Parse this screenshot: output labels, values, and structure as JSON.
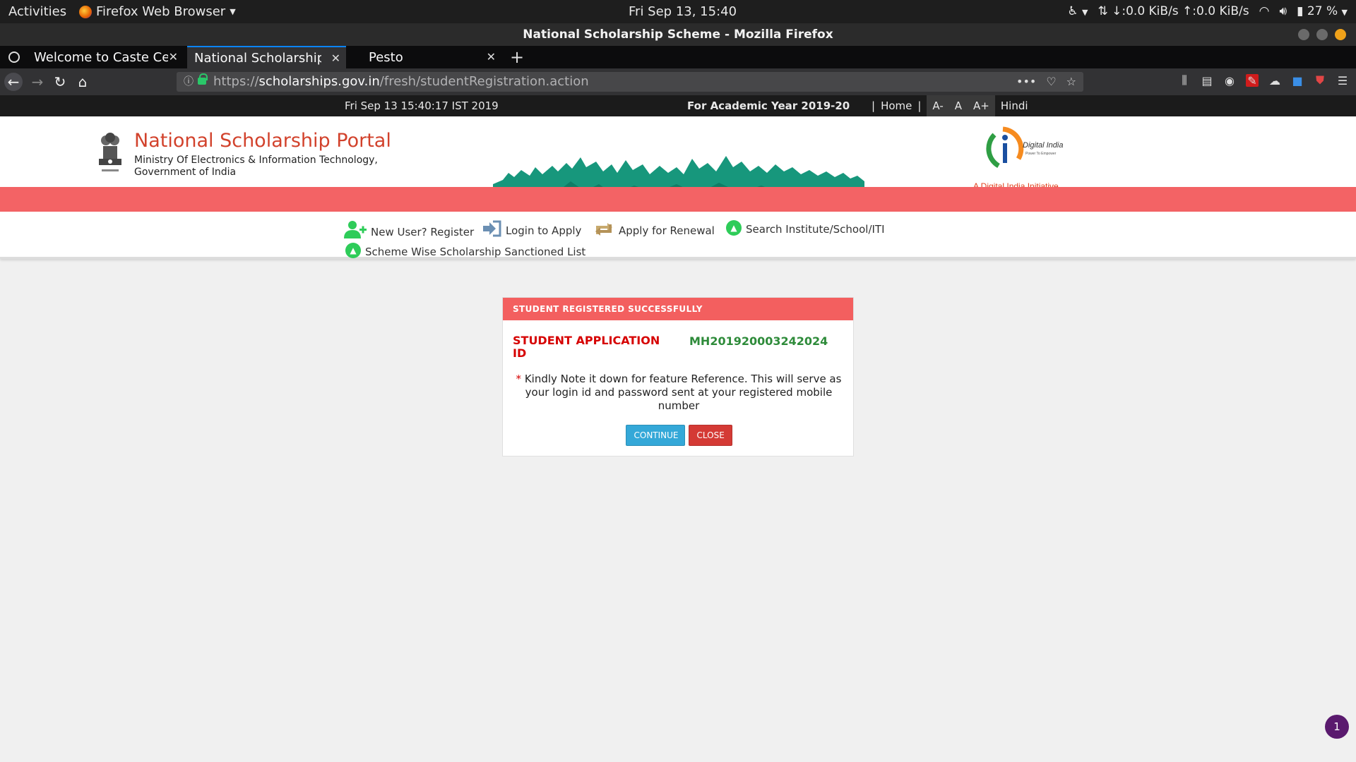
{
  "gnome_bar": {
    "activities": "Activities",
    "app_name": "Firefox Web Browser",
    "clock": "Fri Sep 13, 15:40",
    "network_speed": "↓:0.0 KiB/s ↑:0.0 KiB/s",
    "battery": "27 %"
  },
  "window": {
    "title": "National Scholarship Scheme - Mozilla Firefox"
  },
  "tabs": [
    {
      "title": "Welcome to Caste Cer"
    },
    {
      "title": "National Scholarship S"
    },
    {
      "title": "Pesto"
    }
  ],
  "urlbar": {
    "scheme": "https://",
    "host": "scholarships.gov.in",
    "path": "/fresh/studentRegistration.action"
  },
  "page": {
    "info_strip": {
      "server_time": "Fri Sep 13 15:40:17 IST 2019",
      "academic_year": "For Academic Year 2019-20",
      "sep1": "|",
      "home": "Home",
      "sep2": "|",
      "font_small": "A-",
      "font_normal": "A",
      "font_large": "A+",
      "language": "Hindi"
    },
    "header": {
      "portal_title": "National Scholarship Portal",
      "ministry_line1": "Ministry Of Electronics & Information Technology,",
      "ministry_line2": "Government of India",
      "digital_india_caption": "A Digital India Initiative",
      "digital_india_logo_text": "Digital India",
      "digital_india_tagline": "Power To Empower"
    },
    "menu": {
      "register": "New User? Register",
      "login": "Login to Apply",
      "renewal": "Apply for Renewal",
      "search": "Search Institute/School/ITI",
      "sanctioned": "Scheme Wise Scholarship Sanctioned List"
    },
    "success_box": {
      "header": "STUDENT REGISTERED SUCCESSFULLY",
      "id_label": "STUDENT APPLICATION ID",
      "id_value": "MH201920003242024",
      "note_asterisk": "*",
      "note": "Kindly Note it down for feature Reference. This will serve as your login id and password sent at your registered mobile number",
      "continue": "CONTINUE",
      "close": "CLOSE"
    },
    "floating_badge": "1"
  }
}
